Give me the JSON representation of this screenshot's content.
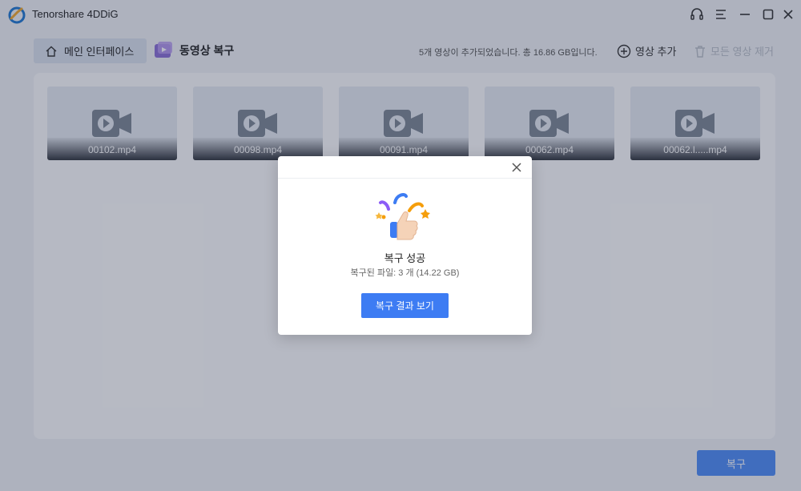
{
  "app": {
    "title": "Tenorshare 4DDiG"
  },
  "window_controls": [
    "headset-icon",
    "menu-icon",
    "minimize-icon",
    "maximize-icon",
    "close-icon"
  ],
  "nav": {
    "home_label": "메인 인터페이스",
    "breadcrumb": "동영상 복구"
  },
  "toolbar": {
    "summary": "5개 영상이 추가되었습니다. 총 16.86 GB입니다.",
    "add_video": "영상 추가",
    "remove_all": "모든 영상 제거"
  },
  "videos": [
    {
      "name": "00102.mp4"
    },
    {
      "name": "00098.mp4"
    },
    {
      "name": "00091.mp4"
    },
    {
      "name": "00062.mp4"
    },
    {
      "name": "00062.l.....mp4"
    }
  ],
  "recover_button": "복구",
  "dialog": {
    "title": "복구 성공",
    "subtitle": "복구된 파일: 3 개 (14.22 GB)",
    "button": "복구 결과 보기"
  },
  "colors": {
    "accent": "#3d7cf3",
    "accent_disabled": "#4f8cf7",
    "panel": "#fdfdfe",
    "card": "#e6eaf2"
  }
}
